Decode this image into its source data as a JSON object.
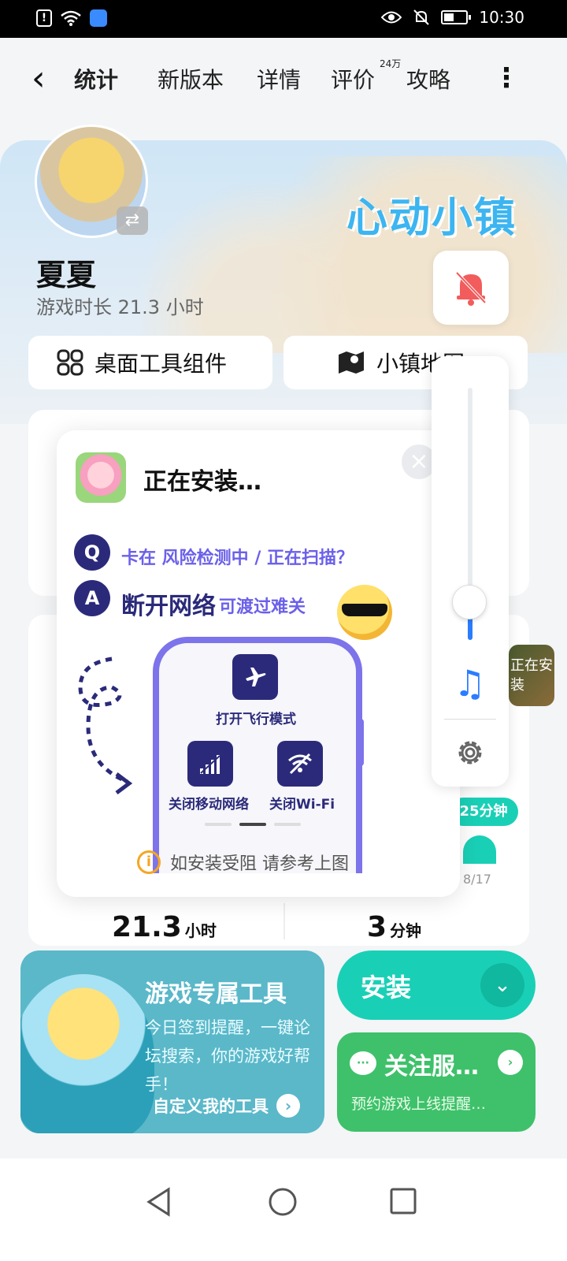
{
  "status_bar": {
    "time": "10:30",
    "alert_glyph": "!"
  },
  "nav": {
    "back_glyph": "‹",
    "tabs": [
      {
        "label": "统计",
        "active": true
      },
      {
        "label": "新版本",
        "active": false
      },
      {
        "label": "详情",
        "active": false
      },
      {
        "label": "评价",
        "active": false
      },
      {
        "label": "攻略",
        "active": false
      }
    ],
    "review_count": "24万",
    "more_glyph": "⋮"
  },
  "hero": {
    "logo_text": "心动小镇",
    "user_name": "夏夏",
    "play_time": "游戏时长 21.3 小时",
    "desktop_widgets_label": "桌面工具组件",
    "town_map_label": "小镇地图"
  },
  "background_stats": {
    "thumb_label": "正在安装",
    "minutes_pill": "25分钟",
    "bar_date": "8/17",
    "total_hours_value": "21.3",
    "total_hours_unit": "小时",
    "recent_minutes_value": "3",
    "recent_minutes_unit": "分钟"
  },
  "popup": {
    "title": "正在安装…",
    "q_badge": "Q",
    "question": "卡在 风险检测中 / 正在扫描？",
    "a_badge": "A",
    "answer_main": "断开网络",
    "answer_sub": "可渡过难关",
    "steps": [
      {
        "label": "打开飞行模式",
        "icon": "airplane-icon"
      },
      {
        "label": "关闭移动网络",
        "icon": "cellular-icon"
      },
      {
        "label": "关闭Wi-Fi",
        "icon": "wifi-off-icon"
      }
    ],
    "page_count": 3,
    "active_page": 2,
    "tip": "如安装受阻 请参考上图",
    "close_glyph": "×"
  },
  "volume_panel": {
    "level_fraction": 0.12,
    "note_glyph": "♫"
  },
  "bottom": {
    "tools_title": "游戏专属工具",
    "tools_desc": "今日签到提醒，一键论坛搜索，你的游戏好帮手！",
    "tools_link": "自定义我的工具",
    "install_label": "安装",
    "follow_title": "关注服…",
    "follow_desc": "预约游戏上线提醒…",
    "chat_glyph": "···",
    "arrow_glyph": "›",
    "dropdown_glyph": "⌄"
  },
  "colors": {
    "accent": "#19d0b6",
    "navy": "#2b2a7a",
    "purple": "#6b60ea",
    "green": "#3ec16a",
    "teal_card": "#5ab8c9",
    "bell_red": "#f25c5c"
  }
}
